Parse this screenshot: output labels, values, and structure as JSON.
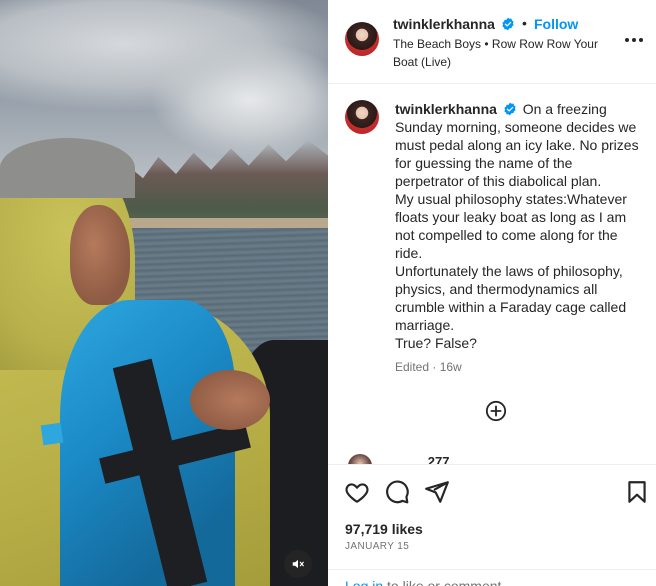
{
  "media": {
    "mute_icon": "speaker-muted-icon"
  },
  "header": {
    "username": "twinklerkhanna",
    "verified_icon": "verified-badge-icon",
    "separator": "•",
    "follow_label": "Follow",
    "audio_text": "The Beach Boys • Row Row Row Your Boat (Live)",
    "more_icon": "more-options-icon"
  },
  "caption": {
    "username": "twinklerkhanna",
    "lines": [
      "On a freezing Sunday morning, someone decides we must pedal along an icy lake. No prizes for guessing the name of the perpetrator of this diabolical plan.",
      "My usual philosophy states:Whatever floats your leaky boat as long as I am not compelled to come along for the ride.",
      "Unfortunately the laws of philosophy, physics, and thermodynamics all crumble within a Faraday cage called marriage.",
      "True? False?"
    ],
    "edited": "Edited · 16w"
  },
  "comment_peek": {
    "text": "...... ... 277 ...... ."
  },
  "actions": {
    "like_icon": "heart-icon",
    "comment_icon": "comment-icon",
    "share_icon": "share-icon",
    "save_icon": "bookmark-icon",
    "likes": "97,719 likes",
    "date": "JANUARY 15"
  },
  "login": {
    "link": "Log in",
    "rest": " to like or comment."
  },
  "colors": {
    "accent": "#0095f6",
    "text": "#262626",
    "muted": "#737373"
  }
}
